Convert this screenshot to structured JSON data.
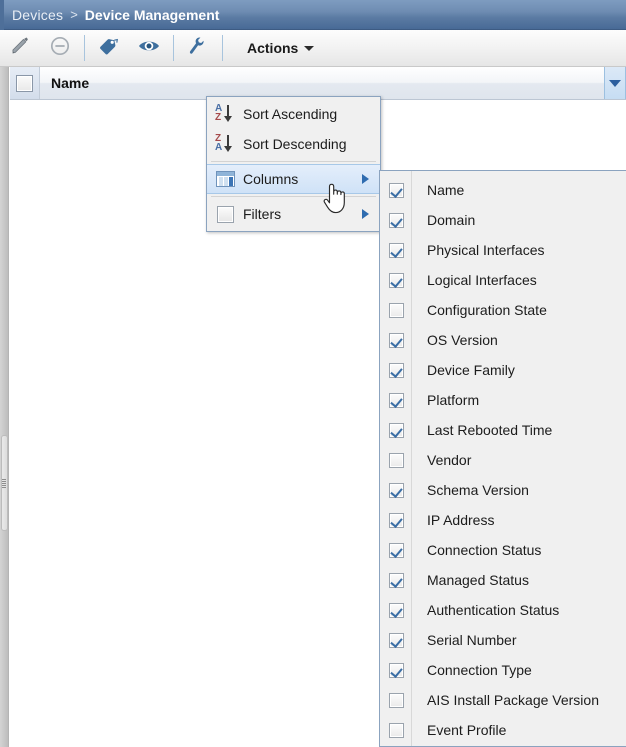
{
  "breadcrumb": {
    "parent": "Devices",
    "separator": ">",
    "current": "Device Management"
  },
  "toolbar": {
    "buttons": [
      {
        "name": "edit-icon",
        "glyph": "pencil",
        "tooltip": "Edit"
      },
      {
        "name": "delete-icon",
        "glyph": "minus-circle",
        "tooltip": "Delete"
      },
      {
        "name": "tag-icon",
        "glyph": "tag",
        "tooltip": "Tag"
      },
      {
        "name": "view-icon",
        "glyph": "eye",
        "tooltip": "View"
      },
      {
        "name": "configure-icon",
        "glyph": "wrench",
        "tooltip": "Configure"
      }
    ],
    "actions_label": "Actions"
  },
  "grid": {
    "select_all_checked": false,
    "columns": [
      {
        "label": "Name"
      }
    ],
    "header_dropdown_active": true,
    "rows": []
  },
  "context_menu": {
    "items": [
      {
        "label": "Sort Ascending",
        "icon": "sort-ascending-icon",
        "selected": false,
        "submenu": false
      },
      {
        "label": "Sort Descending",
        "icon": "sort-descending-icon",
        "selected": false,
        "submenu": false
      },
      {
        "label": "Columns",
        "icon": "columns-icon",
        "selected": true,
        "submenu": true
      },
      {
        "label": "Filters",
        "icon": "filters-icon",
        "selected": false,
        "submenu": true
      }
    ]
  },
  "columns_submenu": {
    "items": [
      {
        "label": "Name",
        "checked": true
      },
      {
        "label": "Domain",
        "checked": true
      },
      {
        "label": "Physical Interfaces",
        "checked": true
      },
      {
        "label": "Logical Interfaces",
        "checked": true
      },
      {
        "label": "Configuration State",
        "checked": false
      },
      {
        "label": "OS Version",
        "checked": true
      },
      {
        "label": "Device Family",
        "checked": true
      },
      {
        "label": "Platform",
        "checked": true
      },
      {
        "label": "Last Rebooted Time",
        "checked": true
      },
      {
        "label": "Vendor",
        "checked": false
      },
      {
        "label": "Schema Version",
        "checked": true
      },
      {
        "label": "IP Address",
        "checked": true
      },
      {
        "label": "Connection Status",
        "checked": true
      },
      {
        "label": "Managed Status",
        "checked": true
      },
      {
        "label": "Authentication Status",
        "checked": true
      },
      {
        "label": "Serial Number",
        "checked": true
      },
      {
        "label": "Connection Type",
        "checked": true
      },
      {
        "label": "AIS Install Package Version",
        "checked": false
      },
      {
        "label": "Event Profile",
        "checked": false
      }
    ]
  },
  "sort_glyphs": {
    "ascending_top": "A",
    "ascending_bottom": "Z",
    "descending_top": "Z",
    "descending_bottom": "A"
  },
  "cursor": {
    "type": "pointing-hand"
  },
  "colors": {
    "header_gradient_top": "#7e9cc0",
    "header_gradient_bottom": "#486a96",
    "menu_background": "#f0f0f0",
    "menu_border": "#8ba3bf",
    "selected_row": "#cfe2f7",
    "checkbox_check": "#3a6ea5",
    "arrow_blue": "#2f6cb0"
  }
}
